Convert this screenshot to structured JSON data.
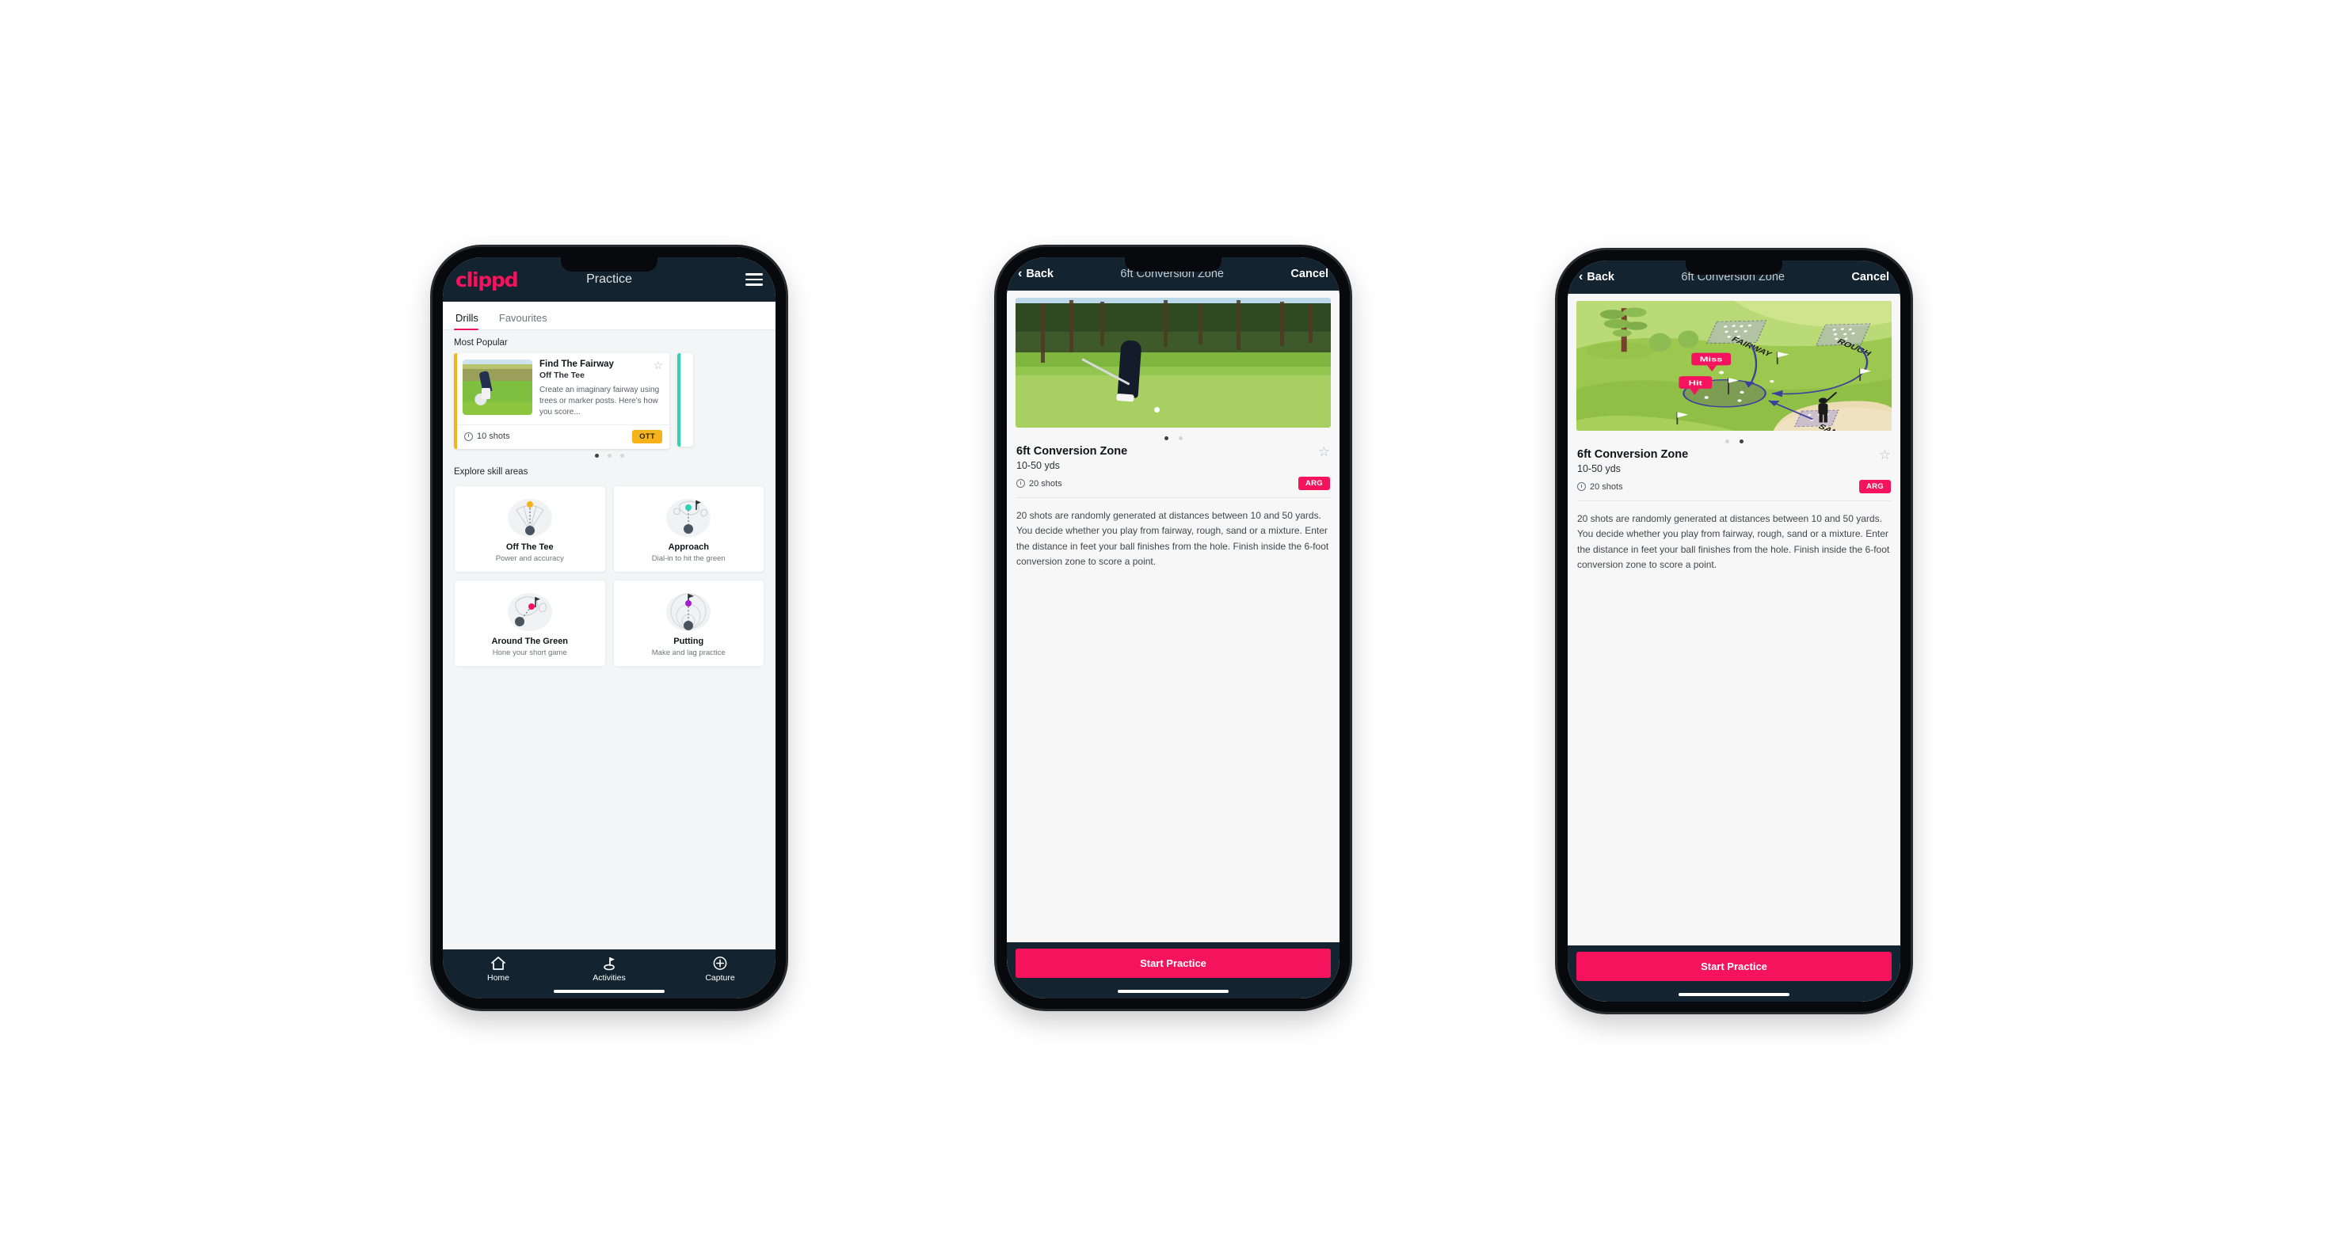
{
  "brand": {
    "logo_text": "clippd",
    "accent": "#f5135e",
    "dark": "#132430",
    "amber": "#f5b21a",
    "teal": "#2ed3b7"
  },
  "phone1": {
    "appbar": {
      "logo": "clippd",
      "title": "Practice",
      "menu_icon": "hamburger-icon"
    },
    "tabs": [
      {
        "label": "Drills",
        "active": true
      },
      {
        "label": "Favourites",
        "active": false
      }
    ],
    "most_popular": {
      "section_label": "Most Popular",
      "card": {
        "title": "Find The Fairway",
        "subtitle": "Off The Tee",
        "description": "Create an imaginary fairway using trees or marker posts. Here's how you score...",
        "shots": "10 shots",
        "badge": "OTT",
        "favourite_icon": "star-outline-icon",
        "accent": "#f5b21a"
      },
      "dots": [
        true,
        false,
        false
      ]
    },
    "explore": {
      "section_label": "Explore skill areas",
      "items": [
        {
          "name": "Off The Tee",
          "desc": "Power and accuracy",
          "icon": "tee-fan-icon",
          "dot_color": "#f5b21a"
        },
        {
          "name": "Approach",
          "desc": "Dial-in to hit the green",
          "icon": "green-approach-icon",
          "dot_color": "#2ed3b7"
        },
        {
          "name": "Around The Green",
          "desc": "Hone your short game",
          "icon": "chip-green-icon",
          "dot_color": "#f5135e"
        },
        {
          "name": "Putting",
          "desc": "Make and lag practice",
          "icon": "putting-rings-icon",
          "dot_color": "#a020d0"
        }
      ]
    },
    "tabbar": [
      {
        "label": "Home",
        "icon": "home-icon",
        "active": false
      },
      {
        "label": "Activities",
        "icon": "golf-flag-icon",
        "active": true
      },
      {
        "label": "Capture",
        "icon": "plus-circle-icon",
        "active": false
      }
    ]
  },
  "phone2": {
    "navbar": {
      "back": "Back",
      "title": "6ft Conversion Zone",
      "cancel": "Cancel",
      "back_icon": "chevron-left-icon"
    },
    "hero": {
      "type": "photo",
      "alt": "golfer-chipping-photo"
    },
    "dots": [
      true,
      false
    ],
    "detail": {
      "title": "6ft Conversion Zone",
      "distance": "10-50 yds",
      "shots": "20 shots",
      "badge": "ARG",
      "favourite_icon": "star-outline-icon",
      "description": "20 shots are randomly generated at distances between 10 and 50 yards. You decide whether you play from fairway, rough, sand or a mixture. Enter the distance in feet your ball finishes from the hole. Finish inside the 6-foot conversion zone to score a point."
    },
    "cta": "Start Practice"
  },
  "phone3": {
    "navbar": {
      "back": "Back",
      "title": "6ft Conversion Zone",
      "cancel": "Cancel",
      "back_icon": "chevron-left-icon"
    },
    "hero": {
      "type": "illustration",
      "labels": {
        "fairway": "FAIRWAY",
        "rough": "ROUGH",
        "sand": "SAND",
        "miss": "Miss",
        "hit": "Hit"
      }
    },
    "dots": [
      false,
      true
    ],
    "detail": {
      "title": "6ft Conversion Zone",
      "distance": "10-50 yds",
      "shots": "20 shots",
      "badge": "ARG",
      "favourite_icon": "star-outline-icon",
      "description": "20 shots are randomly generated at distances between 10 and 50 yards. You decide whether you play from fairway, rough, sand or a mixture. Enter the distance in feet your ball finishes from the hole. Finish inside the 6-foot conversion zone to score a point."
    },
    "cta": "Start Practice"
  }
}
